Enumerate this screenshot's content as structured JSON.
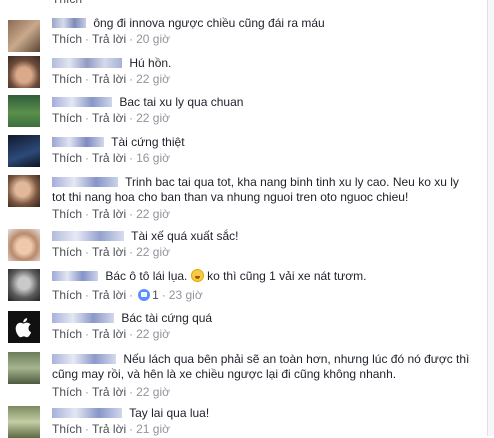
{
  "actions": {
    "like": "Thích",
    "reply": "Trả lời",
    "sep": "·"
  },
  "comments": [
    {
      "text": "ông đi innova ngược chiều cũng đái ra máu",
      "time": "20 giờ"
    },
    {
      "text": "Hú hồn.",
      "time": "22 giờ"
    },
    {
      "text": "Bac tai xu ly qua chuan",
      "time": "22 giờ"
    },
    {
      "text": "Tài cứng thiệt",
      "time": "16 giờ"
    },
    {
      "text_line1": "Trinh bac tai qua tot, kha nang binh tinh xu ly cao. Neu ko xu ly",
      "text_line2": "tot thi nang hoa cho ban than va nhung nguoi tren oto nguoc chieu!",
      "time": "22 giờ"
    },
    {
      "text": "Tài xế quá xuất sắc!",
      "time": "22 giờ"
    },
    {
      "text_before": "Bác ô tô lái lụa.",
      "emoji": "smile-emoji",
      "text_after": "ko thì cũng 1 vải xe nát tươm.",
      "likes": "1",
      "time": "23 giờ"
    },
    {
      "text": "Bác tài cứng quá",
      "time": "22 giờ"
    },
    {
      "text_line1": "Nếu lách qua bên phải sẽ an toàn hơn, nhưng lúc đó nó được thì",
      "text_line2": "cũng may rồi, và hên là xe chiều ngược lại đi cũng không nhanh.",
      "time": "22 giờ"
    },
    {
      "text": "Tay lai qua lua!",
      "time": "21 giờ"
    }
  ]
}
